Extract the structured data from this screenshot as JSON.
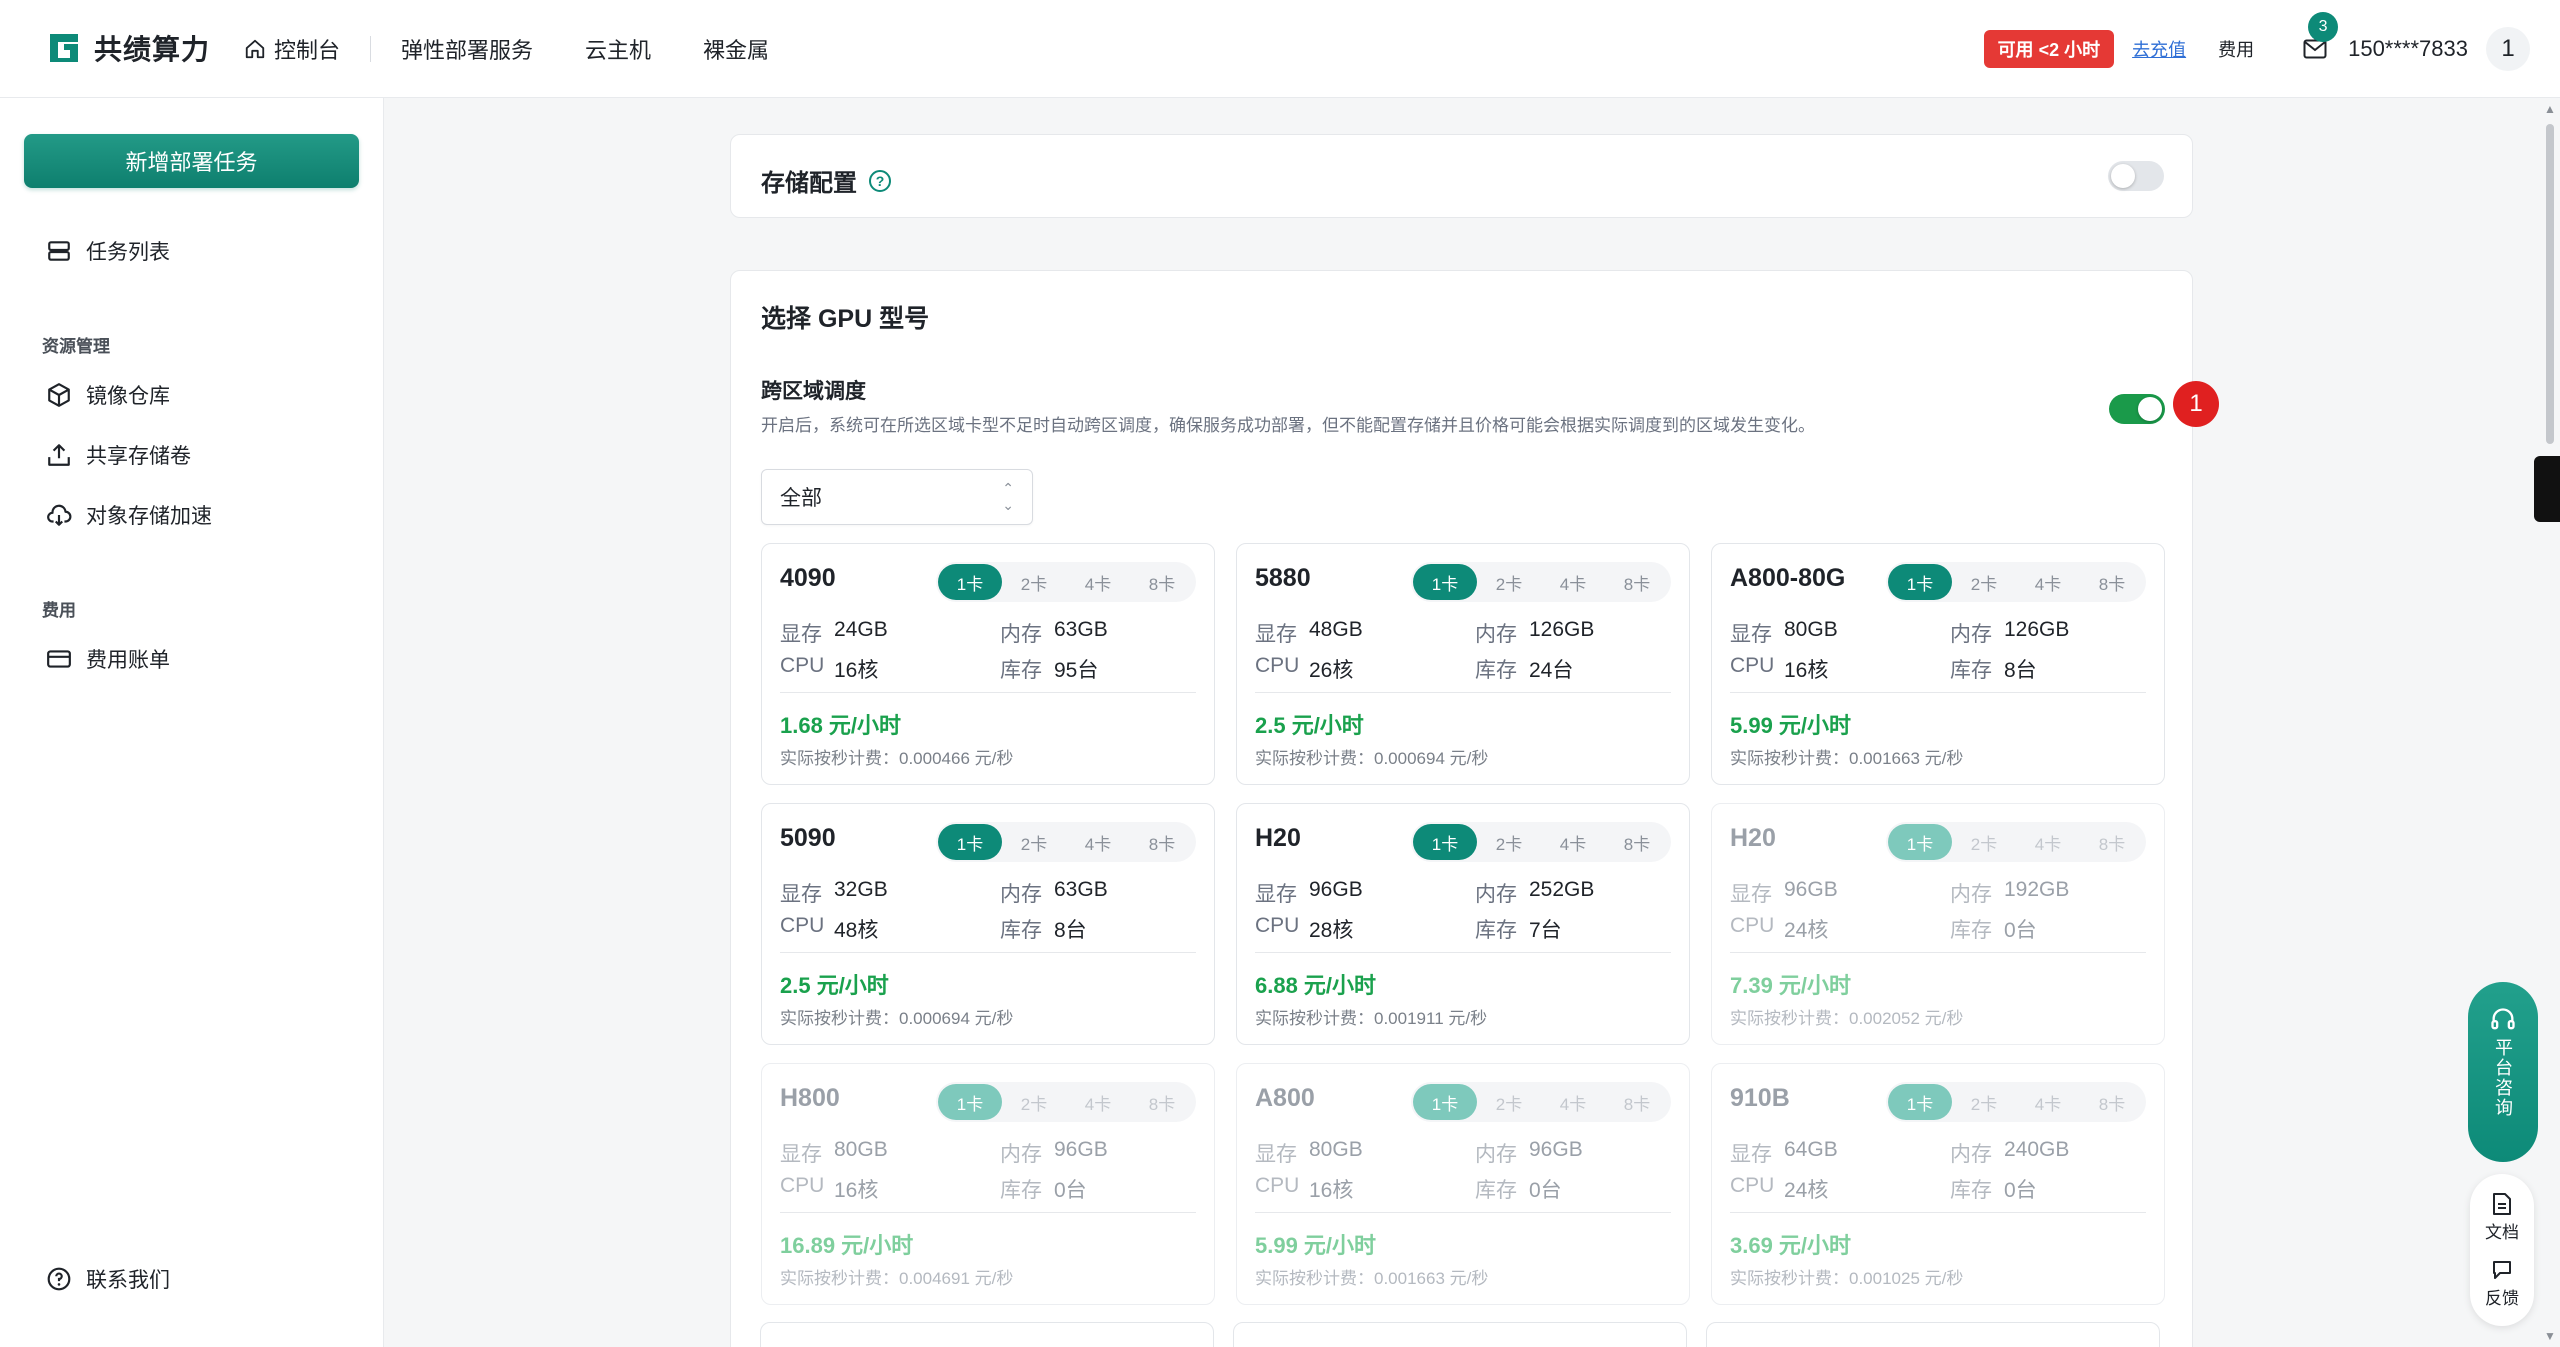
{
  "brand": {
    "name": "共绩算力",
    "accent": "#0d8a78"
  },
  "nav": {
    "items": [
      {
        "label": "控制台",
        "icon": "home-icon"
      },
      {
        "label": "弹性部署服务"
      },
      {
        "label": "云主机"
      },
      {
        "label": "裸金属"
      }
    ]
  },
  "header": {
    "available_badge": "可用 <2 小时",
    "recharge": "去充值",
    "fees": "费用",
    "mail_count": "3",
    "phone": "150****7833",
    "avatar": "1"
  },
  "sidebar": {
    "new_task": "新增部署任务",
    "task_list": "任务列表",
    "section_resources": "资源管理",
    "image_repo": "镜像仓库",
    "shared_volume": "共享存储卷",
    "object_accel": "对象存储加速",
    "section_fees": "费用",
    "bills": "费用账单",
    "contact": "联系我们"
  },
  "storage": {
    "title": "存储配置",
    "help": "?",
    "enabled": false
  },
  "gpu": {
    "title": "选择 GPU 型号",
    "cross_region_title": "跨区域调度",
    "cross_region_desc": "开启后，系统可在所选区域卡型不足时自动跨区调度，确保服务成功部署，但不能配置存储并且价格可能会根据实际调度到的区域发生变化。",
    "cross_region_enabled": true,
    "step_badge": "1",
    "region": "全部",
    "count_options": [
      "1卡",
      "2卡",
      "4卡",
      "8卡"
    ],
    "labels": {
      "vram": "显存",
      "mem": "内存",
      "cpu": "CPU",
      "stock": "库存",
      "per_sec_prefix": "实际按秒计费："
    },
    "cards": [
      {
        "name": "4090",
        "vram": "24GB",
        "mem": "63GB",
        "cpu": "16核",
        "stock": "95台",
        "price": "1.68 元/小时",
        "per_sec": "0.000466 元/秒",
        "available": true
      },
      {
        "name": "5880",
        "vram": "48GB",
        "mem": "126GB",
        "cpu": "26核",
        "stock": "24台",
        "price": "2.5 元/小时",
        "per_sec": "0.000694 元/秒",
        "available": true
      },
      {
        "name": "A800-80G",
        "vram": "80GB",
        "mem": "126GB",
        "cpu": "16核",
        "stock": "8台",
        "price": "5.99 元/小时",
        "per_sec": "0.001663 元/秒",
        "available": true
      },
      {
        "name": "5090",
        "vram": "32GB",
        "mem": "63GB",
        "cpu": "48核",
        "stock": "8台",
        "price": "2.5 元/小时",
        "per_sec": "0.000694 元/秒",
        "available": true
      },
      {
        "name": "H20",
        "vram": "96GB",
        "mem": "252GB",
        "cpu": "28核",
        "stock": "7台",
        "price": "6.88 元/小时",
        "per_sec": "0.001911 元/秒",
        "available": true
      },
      {
        "name": "H20",
        "vram": "96GB",
        "mem": "192GB",
        "cpu": "24核",
        "stock": "0台",
        "price": "7.39 元/小时",
        "per_sec": "0.002052 元/秒",
        "available": false
      },
      {
        "name": "H800",
        "vram": "80GB",
        "mem": "96GB",
        "cpu": "16核",
        "stock": "0台",
        "price": "16.89 元/小时",
        "per_sec": "0.004691 元/秒",
        "available": false
      },
      {
        "name": "A800",
        "vram": "80GB",
        "mem": "96GB",
        "cpu": "16核",
        "stock": "0台",
        "price": "5.99 元/小时",
        "per_sec": "0.001663 元/秒",
        "available": false
      },
      {
        "name": "910B",
        "vram": "64GB",
        "mem": "240GB",
        "cpu": "24核",
        "stock": "0台",
        "price": "3.69 元/小时",
        "per_sec": "0.001025 元/秒",
        "available": false
      }
    ]
  },
  "float": {
    "consult": "平台咨询",
    "docs": "文档",
    "feedback": "反馈"
  }
}
